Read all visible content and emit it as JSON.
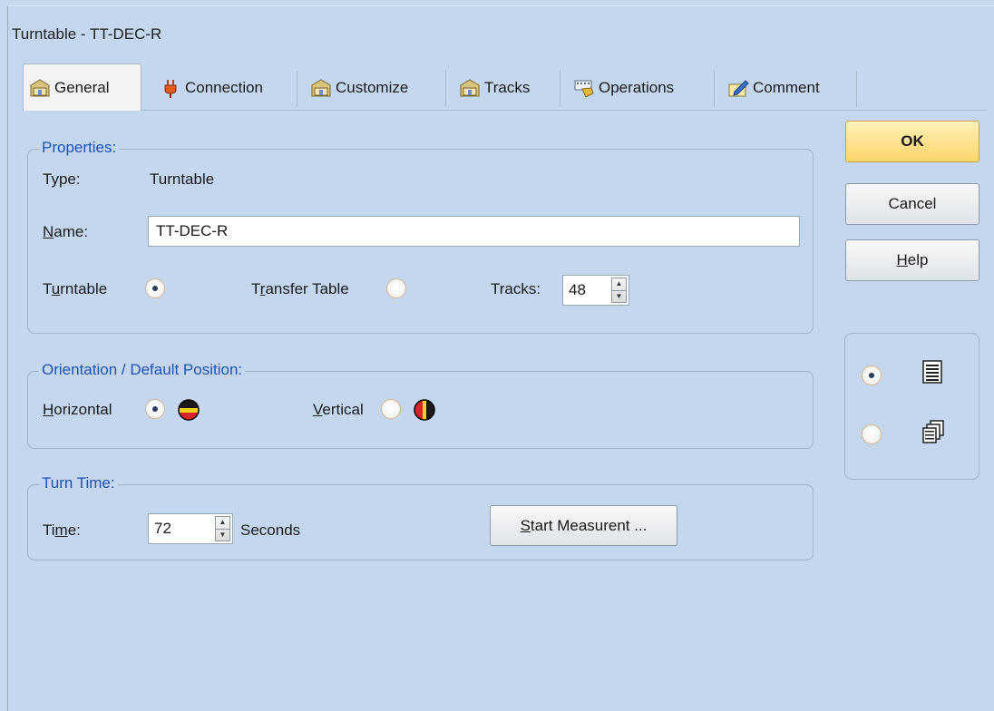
{
  "window": {
    "title": "Turntable - TT-DEC-R"
  },
  "tabs": [
    {
      "label": "General",
      "icon": "folder-house-icon",
      "active": true
    },
    {
      "label": "Connection",
      "icon": "plug-icon"
    },
    {
      "label": "Customize",
      "icon": "folder-house-icon"
    },
    {
      "label": "Tracks",
      "icon": "folder-house-icon"
    },
    {
      "label": "Operations",
      "icon": "keyboard-hand-icon"
    },
    {
      "label": "Comment",
      "icon": "pencil-note-icon"
    }
  ],
  "properties": {
    "legend": "Properties:",
    "type_label": "Type:",
    "type_value": "Turntable",
    "name_label_u": "N",
    "name_label_rest": "ame:",
    "name_value": "TT-DEC-R",
    "turntable_pre": "T",
    "turntable_u": "u",
    "turntable_post": "rntable",
    "turntable_selected": true,
    "transfer_pre": "T",
    "transfer_u": "r",
    "transfer_post": "ansfer Table",
    "transfer_selected": false,
    "tracks_label": "Tracks:",
    "tracks_value": "48"
  },
  "orientation": {
    "legend": "Orientation / Default Position:",
    "horizontal_u": "H",
    "horizontal_rest": "orizontal",
    "horizontal_selected": true,
    "horizontal_icon": "horizontal-disc-icon",
    "vertical_u": "V",
    "vertical_rest": "ertical",
    "vertical_selected": false,
    "vertical_icon": "vertical-disc-icon"
  },
  "turn_time": {
    "legend": "Turn Time:",
    "time_pre": "Ti",
    "time_u": "m",
    "time_post": "e:",
    "time_value": "72",
    "unit": "Seconds",
    "measure_u": "S",
    "measure_rest": "tart Measurent ..."
  },
  "buttons": {
    "ok": "OK",
    "cancel": "Cancel",
    "help_u": "H",
    "help_rest": "elp"
  },
  "view_mode": {
    "single_selected": true,
    "single_icon": "single-page-icon",
    "multi_selected": false,
    "multi_icon": "multi-page-icon"
  },
  "colors": {
    "background": "#c4d7ee",
    "legend_text": "#1c52b8",
    "ok_button": "#fbd56a"
  }
}
